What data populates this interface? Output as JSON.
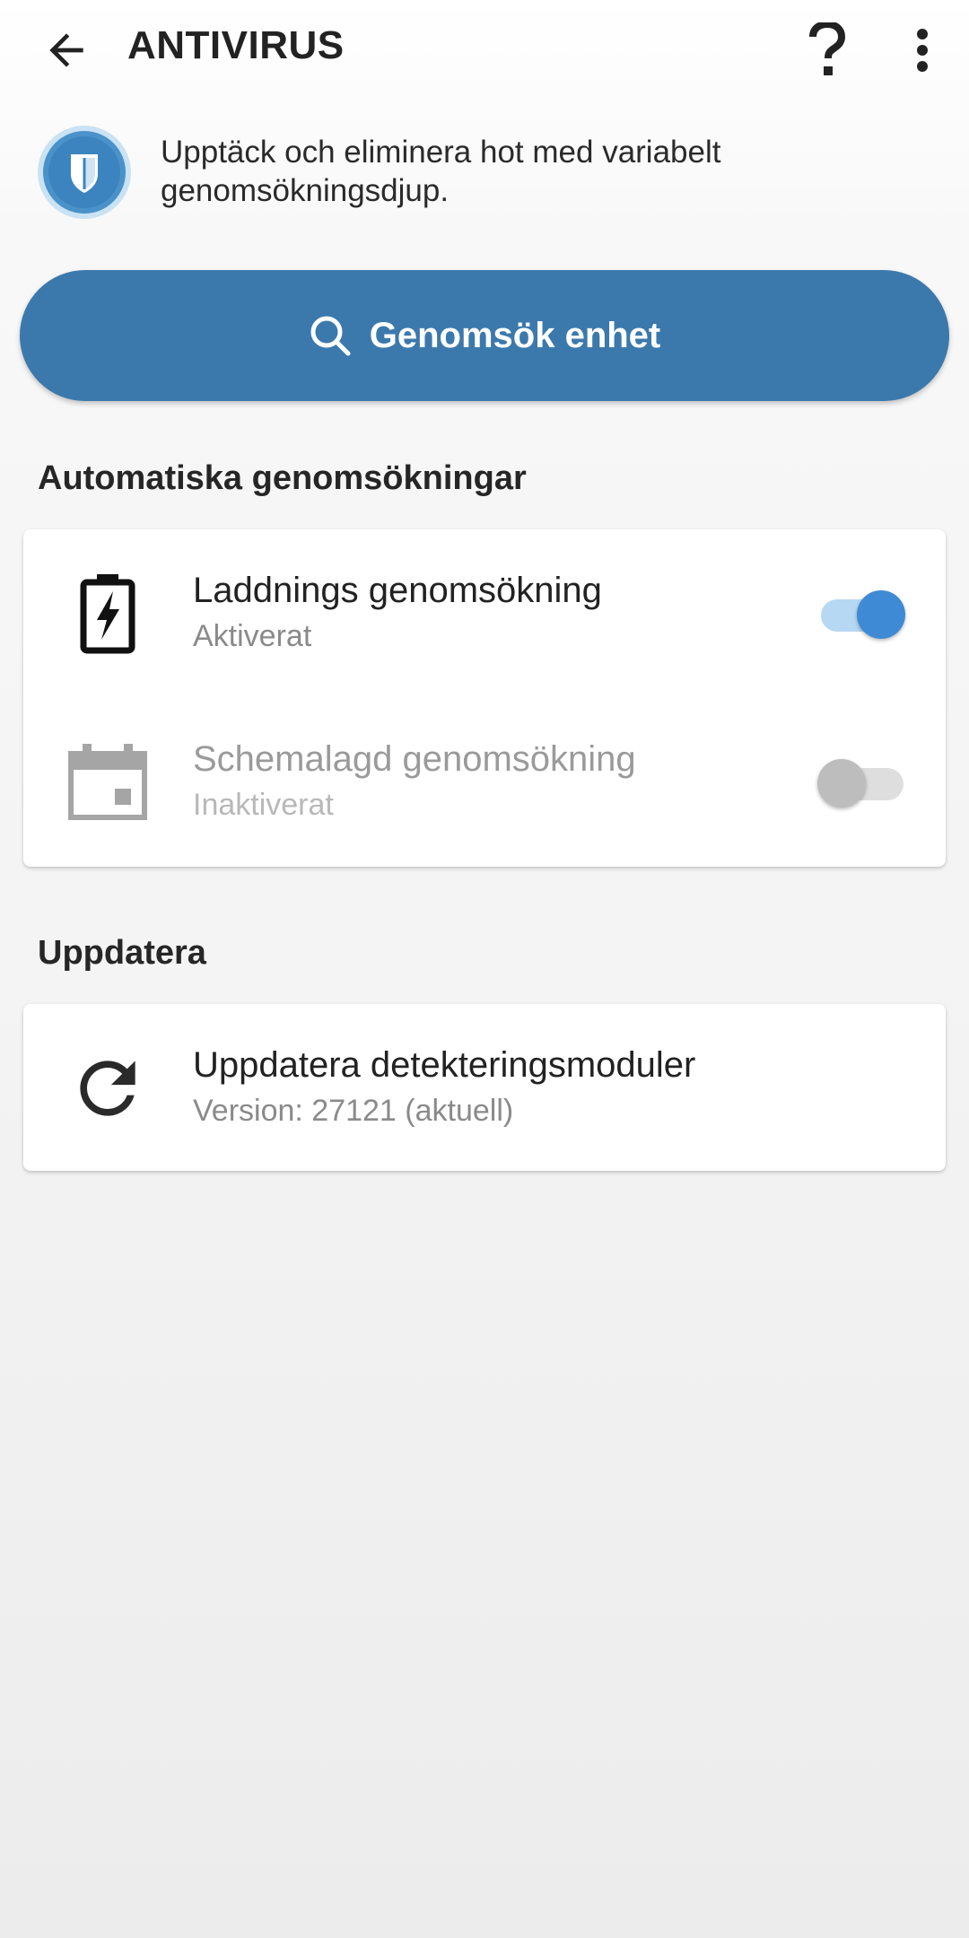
{
  "app_bar": {
    "title": "ANTIVIRUS",
    "back_icon": "arrow-left-icon",
    "help_icon": "question-mark-icon",
    "more_icon": "more-vert-icon"
  },
  "intro": {
    "icon": "shield-icon",
    "text": "Upptäck och eliminera hot med variabelt genomsökningsdjup."
  },
  "scan_button": {
    "label": "Genomsök enhet",
    "icon": "search-icon"
  },
  "auto_scans": {
    "header": "Automatiska genomsökningar",
    "items": [
      {
        "icon": "battery-charging-icon",
        "title": "Laddnings genomsökning",
        "status": "Aktiverat",
        "enabled": true
      },
      {
        "icon": "calendar-icon",
        "title": "Schemalagd genomsökning",
        "status": "Inaktiverat",
        "enabled": false
      }
    ]
  },
  "update": {
    "header": "Uppdatera",
    "item": {
      "icon": "refresh-icon",
      "title": "Uppdatera detekteringsmoduler",
      "subtitle": "Version: 27121 (aktuell)"
    }
  },
  "colors": {
    "primary": "#3b79ad",
    "toggle_on_thumb": "#3f8ad4",
    "toggle_on_track": "#b6d8f3",
    "toggle_off_thumb": "#bdbdbd",
    "toggle_off_track": "#dedede"
  }
}
